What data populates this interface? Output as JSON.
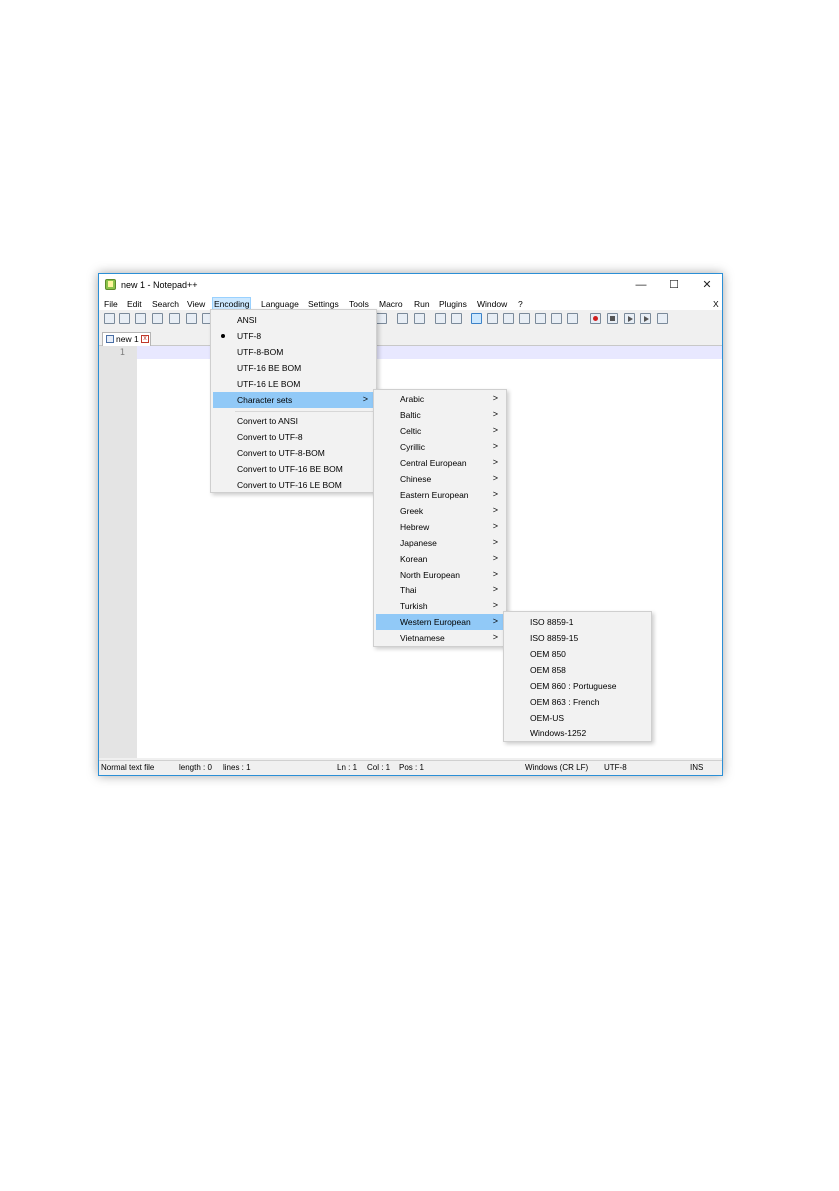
{
  "window": {
    "title": "new 1 - Notepad++",
    "controls": {
      "minimize": "—",
      "maximize": "☐",
      "close": "✕"
    }
  },
  "menubar": {
    "items": [
      "File",
      "Edit",
      "Search",
      "View",
      "Encoding",
      "Language",
      "Settings",
      "Tools",
      "Macro",
      "Run",
      "Plugins",
      "Window",
      "?"
    ],
    "active": "Encoding",
    "close_x": "X"
  },
  "tab": {
    "label": "new 1",
    "close": "x"
  },
  "editor": {
    "line_number": "1",
    "current_line_color": "#e8e8ff"
  },
  "status": {
    "file_type": "Normal text file",
    "length": "length : 0",
    "lines": "lines : 1",
    "ln": "Ln : 1",
    "col": "Col : 1",
    "pos": "Pos : 1",
    "eol": "Windows (CR LF)",
    "encoding": "UTF-8",
    "mode": "INS"
  },
  "encoding_menu": {
    "items": [
      "ANSI",
      "UTF-8",
      "UTF-8-BOM",
      "UTF-16 BE BOM",
      "UTF-16 LE BOM",
      "Character sets",
      "Convert to ANSI",
      "Convert to UTF-8",
      "Convert to UTF-8-BOM",
      "Convert to UTF-16 BE BOM",
      "Convert to UTF-16 LE BOM"
    ],
    "selected": "UTF-8",
    "highlighted": "Character sets"
  },
  "charsets_menu": {
    "items": [
      "Arabic",
      "Baltic",
      "Celtic",
      "Cyrillic",
      "Central European",
      "Chinese",
      "Eastern European",
      "Greek",
      "Hebrew",
      "Japanese",
      "Korean",
      "North European",
      "Thai",
      "Turkish",
      "Western European",
      "Vietnamese"
    ],
    "highlighted": "Western European"
  },
  "western_menu": {
    "items": [
      "ISO 8859-1",
      "ISO 8859-15",
      "OEM 850",
      "OEM 858",
      "OEM 860 : Portuguese",
      "OEM 863 : French",
      "OEM-US",
      "Windows-1252"
    ]
  },
  "colors": {
    "highlight": "#91c9f7",
    "accent": "#2b8fd6"
  }
}
